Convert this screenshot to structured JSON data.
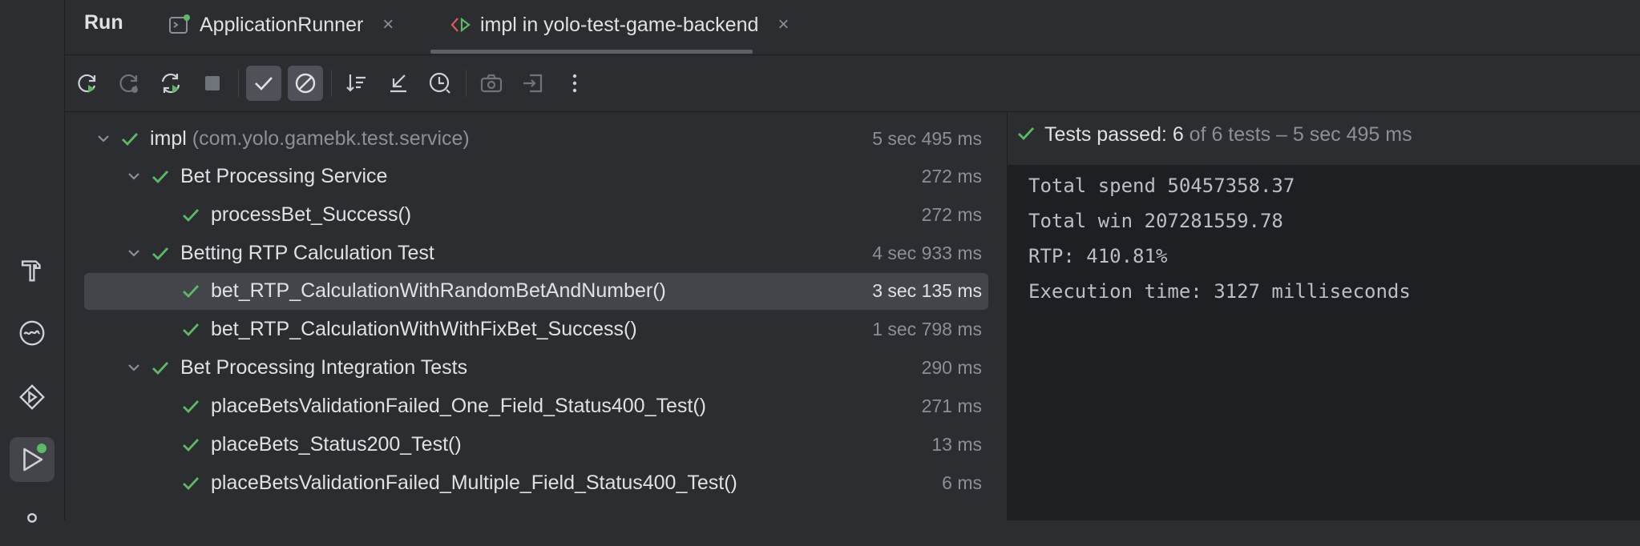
{
  "header": {
    "run_label": "Run",
    "tabs": [
      {
        "label": "ApplicationRunner",
        "icon": "application-run-config-icon"
      },
      {
        "label": "impl in yolo-test-game-backend",
        "icon": "junit-test-icon"
      }
    ],
    "close_glyph": "×"
  },
  "toolbar": {
    "buttons": [
      "rerun-icon",
      "rerun-failed-icon",
      "toggle-auto-test-icon",
      "stop-icon",
      "show-passed-icon",
      "show-ignored-icon",
      "sort-icon",
      "collapse-all-icon",
      "history-icon",
      "export-icon",
      "import-icon",
      "more-options-icon"
    ]
  },
  "tree": {
    "rows": [
      {
        "label": "impl",
        "pkg": "(com.yolo.gamebk.test.service)",
        "time": "5 sec 495 ms"
      },
      {
        "label": "Bet Processing Service",
        "time": "272 ms"
      },
      {
        "label": "processBet_Success()",
        "time": "272 ms"
      },
      {
        "label": "Betting RTP Calculation Test",
        "time": "4 sec 933 ms"
      },
      {
        "label": "bet_RTP_CalculationWithRandomBetAndNumber()",
        "time": "3 sec 135 ms"
      },
      {
        "label": "bet_RTP_CalculationWithWithFixBet_Success()",
        "time": "1 sec 798 ms"
      },
      {
        "label": "Bet Processing Integration Tests",
        "time": "290 ms"
      },
      {
        "label": "placeBetsValidationFailed_One_Field_Status400_Test()",
        "time": "271 ms"
      },
      {
        "label": "placeBets_Status200_Test()",
        "time": "13 ms"
      },
      {
        "label": "placeBetsValidationFailed_Multiple_Field_Status400_Test()",
        "time": "6 ms"
      }
    ]
  },
  "console": {
    "status_prefix": "Tests passed: ",
    "status_count": "6",
    "status_suffix": " of 6 tests – 5 sec 495 ms",
    "lines": [
      "Total spend 50457358.37",
      "Total win 207281559.78",
      "RTP: 410.81%",
      "Execution time: 3127 milliseconds"
    ]
  },
  "colors": {
    "pass_green": "#5fb865",
    "background": "#2b2d30",
    "console_bg": "#1e1f22",
    "muted_text": "#8c8f94"
  }
}
